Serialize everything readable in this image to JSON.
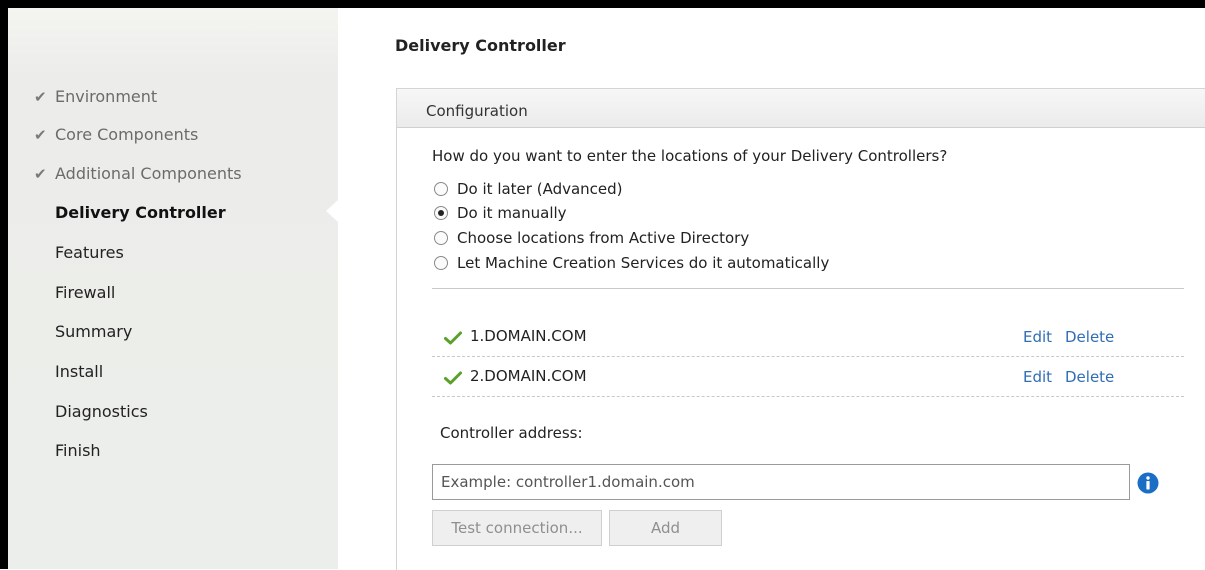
{
  "sidebar": {
    "items": [
      {
        "label": "Environment",
        "state": "done"
      },
      {
        "label": "Core Components",
        "state": "done"
      },
      {
        "label": "Additional Components",
        "state": "done"
      },
      {
        "label": "Delivery Controller",
        "state": "active"
      },
      {
        "label": "Features",
        "state": "pending"
      },
      {
        "label": "Firewall",
        "state": "pending"
      },
      {
        "label": "Summary",
        "state": "pending"
      },
      {
        "label": "Install",
        "state": "pending"
      },
      {
        "label": "Diagnostics",
        "state": "pending"
      },
      {
        "label": "Finish",
        "state": "pending"
      }
    ],
    "check_glyph": "✔"
  },
  "page": {
    "title": "Delivery Controller"
  },
  "panel": {
    "title": "Configuration",
    "question": "How do you want to enter the locations of your Delivery Controllers?",
    "options": [
      {
        "label": "Do it later (Advanced)",
        "selected": false
      },
      {
        "label": "Do it manually",
        "selected": true
      },
      {
        "label": "Choose locations from Active Directory",
        "selected": false
      },
      {
        "label": "Let Machine Creation Services do it automatically",
        "selected": false
      }
    ],
    "controllers": [
      {
        "name": "1.DOMAIN.COM",
        "edit_label": "Edit",
        "delete_label": "Delete"
      },
      {
        "name": "2.DOMAIN.COM",
        "edit_label": "Edit",
        "delete_label": "Delete"
      }
    ],
    "address_label": "Controller address:",
    "address_placeholder": "Example: controller1.domain.com",
    "address_value": "",
    "test_button_label": "Test connection...",
    "add_button_label": "Add"
  },
  "icons": {
    "status_ok": "check-icon",
    "info": "info-icon"
  },
  "colors": {
    "accent_link": "#2f6db5",
    "check_green": "#5aa02c",
    "info_blue": "#1a6fc4"
  }
}
